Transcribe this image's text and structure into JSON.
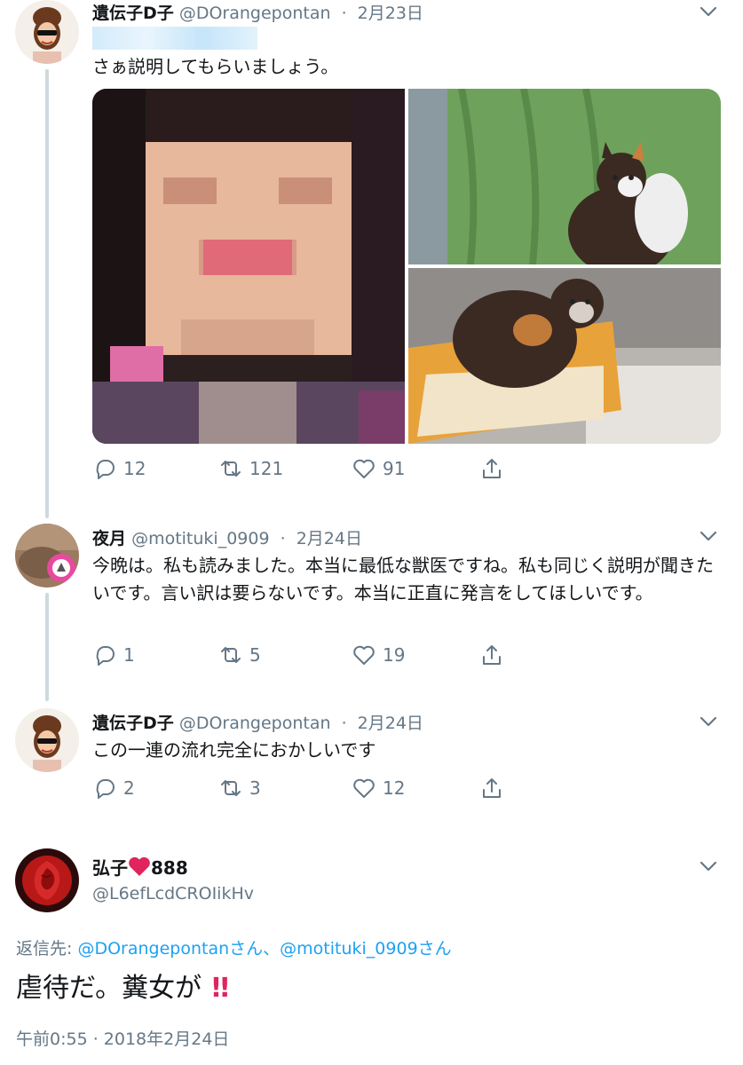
{
  "tweets": [
    {
      "name": "遺伝子D子",
      "handle": "@DOrangepontan",
      "sep": "·",
      "date": "2月23日",
      "text": "さぁ説明してもらいましょう。",
      "reply_count": "12",
      "retweet_count": "121",
      "like_count": "91"
    },
    {
      "name": "夜月",
      "handle": "@motituki_0909",
      "sep": "·",
      "date": "2月24日",
      "text": "今晩は。私も読みました。本当に最低な獣医ですね。私も同じく説明が聞きたいです。言い訳は要らないです。本当に正直に発言をしてほしいです。",
      "reply_count": "1",
      "retweet_count": "5",
      "like_count": "19"
    },
    {
      "name": "遺伝子D子",
      "handle": "@DOrangepontan",
      "sep": "·",
      "date": "2月24日",
      "text": "この一連の流れ完全におかしいです",
      "reply_count": "2",
      "retweet_count": "3",
      "like_count": "12"
    }
  ],
  "focus": {
    "name": "弘子",
    "name_suffix": "888",
    "handle": "@L6efLcdCROIikHv",
    "reply_to_label": "返信先:",
    "reply_mention_1": "@DOrangepontanさん",
    "reply_sep": "、",
    "reply_mention_2": "@motituki_0909さん",
    "text": "虐待だ。糞女が",
    "emoji": "!!",
    "timestamp": "午前0:55 · 2018年2月24日"
  },
  "colors": {
    "accent": "#1da1f2",
    "secondary_text": "#657786",
    "thread_line": "#cfd9de",
    "heart": "#e0245e"
  },
  "icons": [
    "reply-icon",
    "retweet-icon",
    "like-icon",
    "share-icon",
    "chevron-down-icon",
    "heart-emoji-icon",
    "double-exclamation-icon"
  ]
}
